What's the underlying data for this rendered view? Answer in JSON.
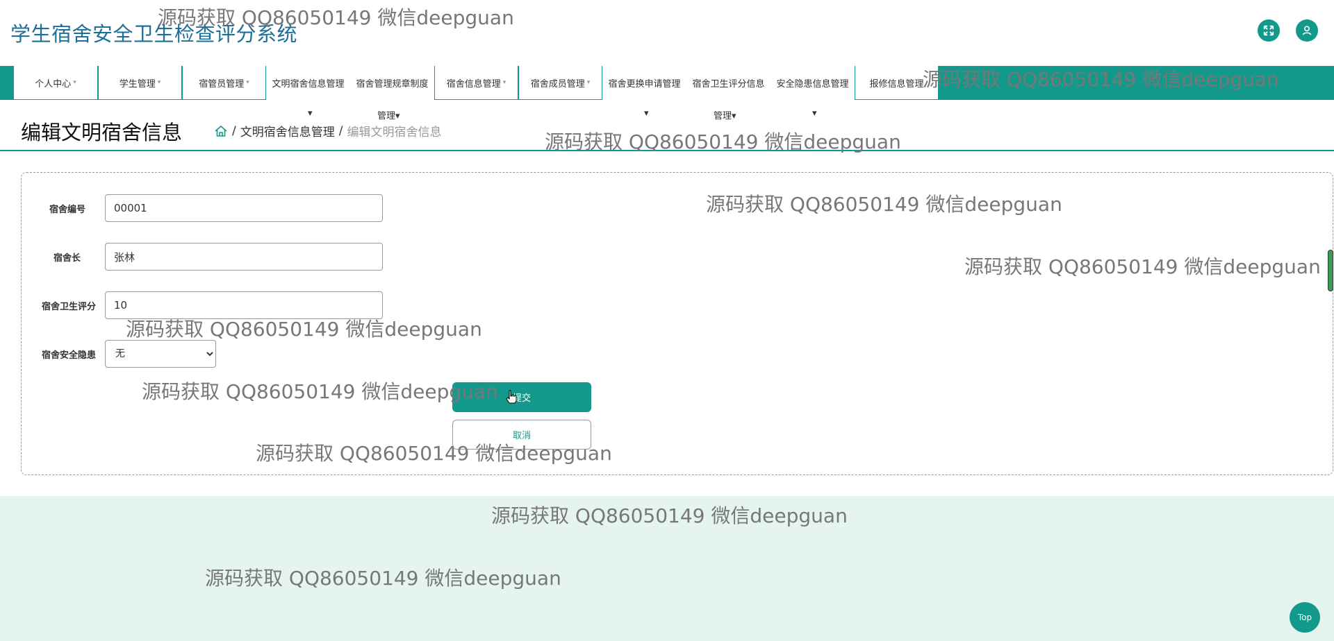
{
  "app": {
    "title": "学生宿舍安全卫生检查评分系统"
  },
  "header": {
    "fullscreen_icon": "expand-icon",
    "user_icon": "user-icon"
  },
  "nav": {
    "items": [
      {
        "label": "个人中心",
        "caret": "▾"
      },
      {
        "label": "学生管理",
        "caret": "▾"
      },
      {
        "label": "宿管员管理",
        "caret": "▾"
      },
      {
        "label": "文明宿舍信息管理",
        "sub": "",
        "caret": "▾"
      },
      {
        "label": "宿舍管理规章制度",
        "sub": "管理",
        "caret": "▾"
      },
      {
        "label": "宿舍信息管理",
        "caret": "▾"
      },
      {
        "label": "宿舍成员管理",
        "caret": "▾"
      },
      {
        "label": "宿舍更换申请管理",
        "sub": "",
        "caret": "▾"
      },
      {
        "label": "宿舍卫生评分信息",
        "sub": "管理",
        "caret": "▾"
      },
      {
        "label": "安全隐患信息管理",
        "sub": "",
        "caret": "▾"
      },
      {
        "label": "报修信息管理",
        "caret": ""
      }
    ]
  },
  "breadcrumb": {
    "page_title": "编辑文明宿舍信息",
    "home_icon": "home-icon",
    "separator": "/",
    "parent": "文明宿舍信息管理",
    "current": "编辑文明宿舍信息"
  },
  "form": {
    "dorm_no_label": "宿舍编号",
    "dorm_no_value": "00001",
    "leader_label": "宿舍长",
    "leader_value": "张林",
    "score_label": "宿舍卫生评分",
    "score_value": "10",
    "hazard_label": "宿舍安全隐患",
    "hazard_selected": "无",
    "submit_label": "提交",
    "cancel_label": "取消"
  },
  "footer": {
    "top_label": "Top"
  },
  "watermark": {
    "text": "源码获取 QQ86050149 微信deepguan"
  }
}
